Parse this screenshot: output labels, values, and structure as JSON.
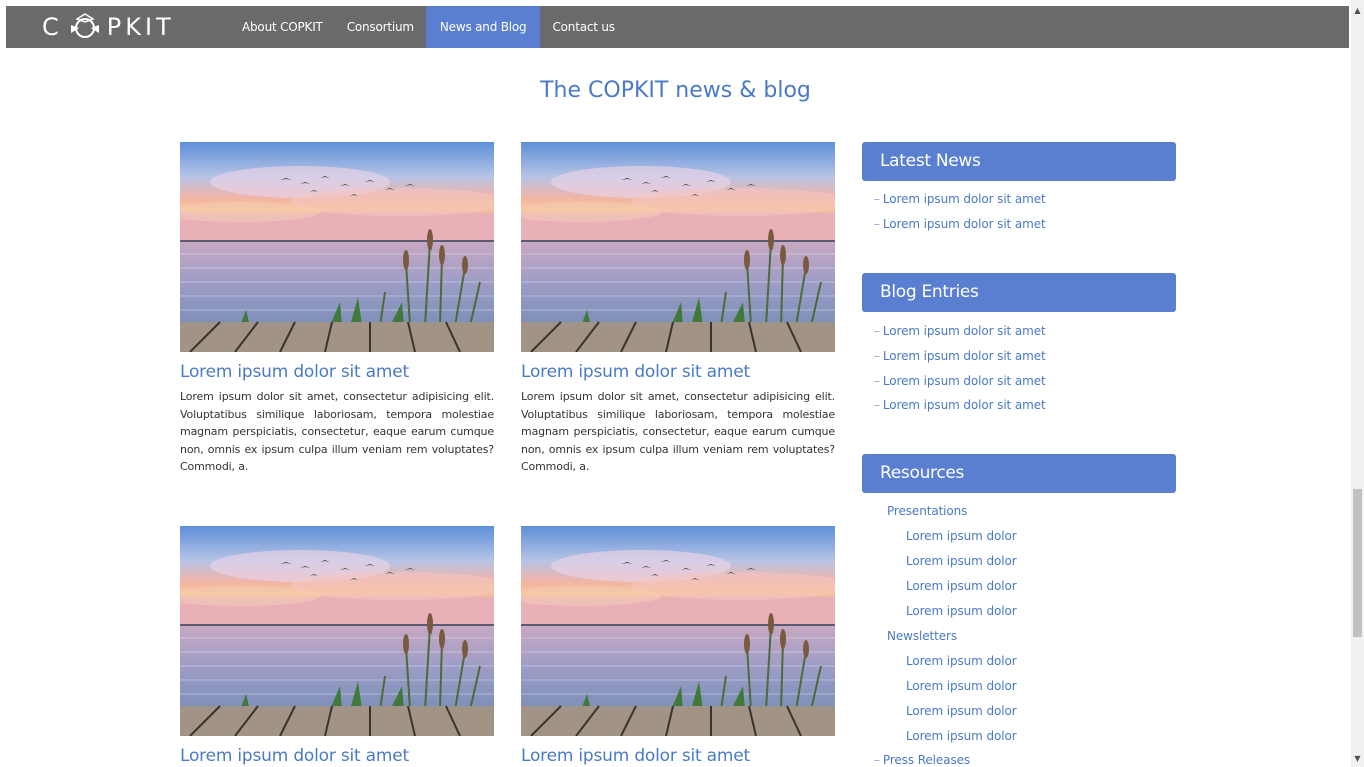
{
  "brand": {
    "left": "C",
    "right": "PKIT"
  },
  "nav": {
    "items": [
      "About COPKIT",
      "Consortium",
      "News and Blog",
      "Contact us"
    ],
    "active_index": 2
  },
  "page": {
    "title": "The COPKIT news & blog"
  },
  "posts": [
    {
      "title": "Lorem ipsum dolor sit amet",
      "body": "Lorem ipsum dolor sit amet, consectetur adipisicing elit. Voluptatibus similique laboriosam, tempora molestiae magnam perspiciatis, consectetur, eaque earum cumque non, omnis ex ipsum culpa illum veniam rem voluptates? Commodi, a."
    },
    {
      "title": "Lorem ipsum dolor sit amet",
      "body": "Lorem ipsum dolor sit amet, consectetur adipisicing elit. Voluptatibus similique laboriosam, tempora molestiae magnam perspiciatis, consectetur, eaque earum cumque non, omnis ex ipsum culpa illum veniam rem voluptates? Commodi, a."
    },
    {
      "title": "Lorem ipsum dolor sit amet"
    },
    {
      "title": "Lorem ipsum dolor sit amet"
    }
  ],
  "sidebar": {
    "latest_news": {
      "heading": "Latest News",
      "items": [
        "Lorem ipsum dolor sit amet",
        "Lorem ipsum dolor sit amet"
      ]
    },
    "blog_entries": {
      "heading": "Blog Entries",
      "items": [
        "Lorem ipsum dolor sit amet",
        "Lorem ipsum dolor sit amet",
        "Lorem ipsum dolor sit amet",
        "Lorem ipsum dolor sit amet"
      ]
    },
    "resources": {
      "heading": "Resources",
      "presentations": {
        "label": "Presentations",
        "items": [
          "Lorem ipsum dolor",
          "Lorem ipsum dolor",
          "Lorem ipsum dolor",
          "Lorem ipsum dolor"
        ]
      },
      "newsletters": {
        "label": "Newsletters",
        "items": [
          "Lorem ipsum dolor",
          "Lorem ipsum dolor",
          "Lorem ipsum dolor",
          "Lorem ipsum dolor"
        ]
      },
      "press_releases": "Press Releases"
    }
  },
  "colors": {
    "accent": "#5a7fd0",
    "link": "#4a7ac6",
    "nav_bg": "#6a6a6a"
  },
  "icons": {
    "logo_mark": "shield-logo-icon",
    "scroll_up": "triangle-up-icon",
    "scroll_down": "triangle-down-icon"
  }
}
